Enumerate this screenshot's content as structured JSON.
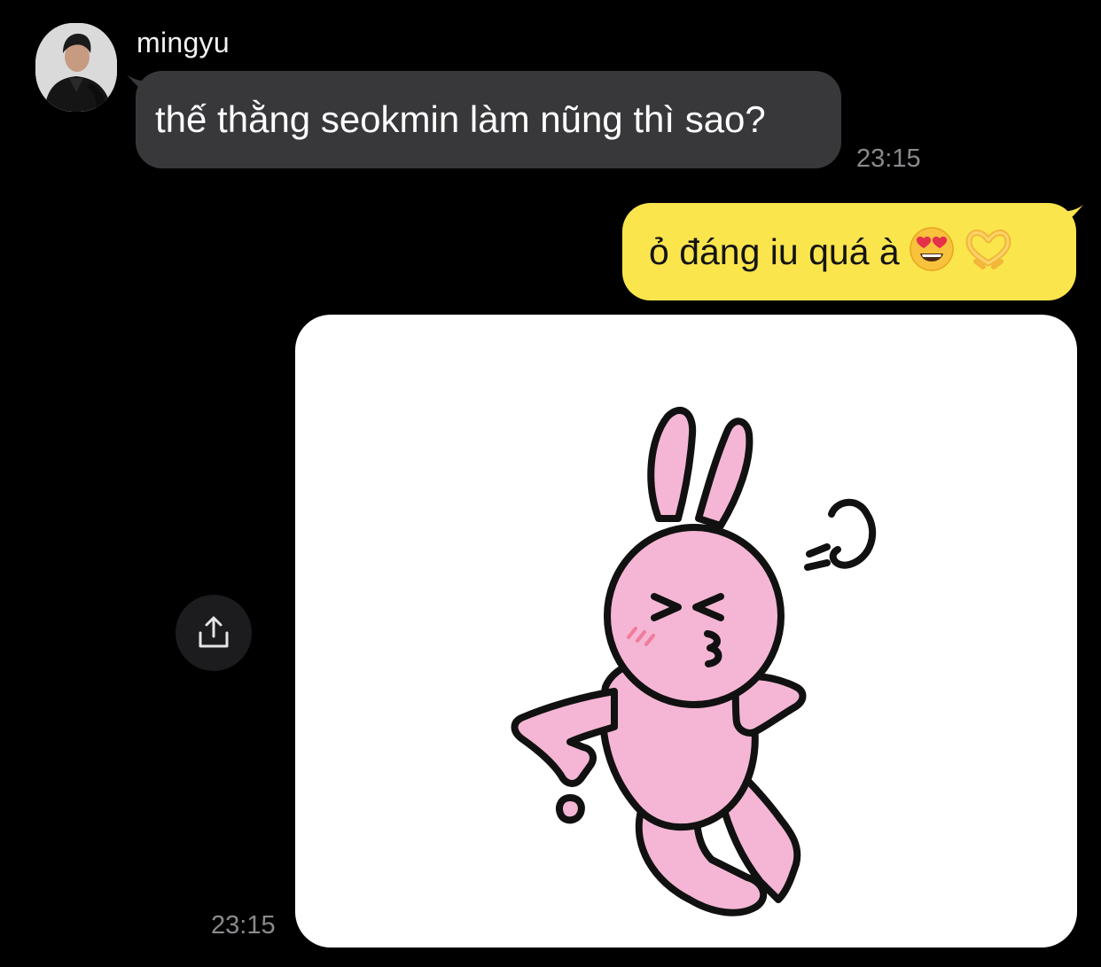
{
  "chat": {
    "messages": [
      {
        "direction": "incoming",
        "sender": "mingyu",
        "avatar_icon": "profile-photo",
        "text": "thế thằng seokmin làm nũng thì sao?",
        "time": "23:15"
      },
      {
        "direction": "outgoing",
        "text": "ỏ đáng iu quá à",
        "emoji": [
          "heart-eyes-face-emoji",
          "heart-hands-emoji"
        ]
      },
      {
        "direction": "outgoing",
        "type": "sticker",
        "sticker_icon": "pink-rabbit-pouting-sticker",
        "time": "23:15",
        "share_icon": "share-icon"
      }
    ]
  },
  "colors": {
    "background": "#000000",
    "incoming_bubble": "#38383a",
    "outgoing_bubble": "#fbe54d",
    "timestamp": "#8a8a8e",
    "sticker_pink": "#f4b6d4"
  }
}
